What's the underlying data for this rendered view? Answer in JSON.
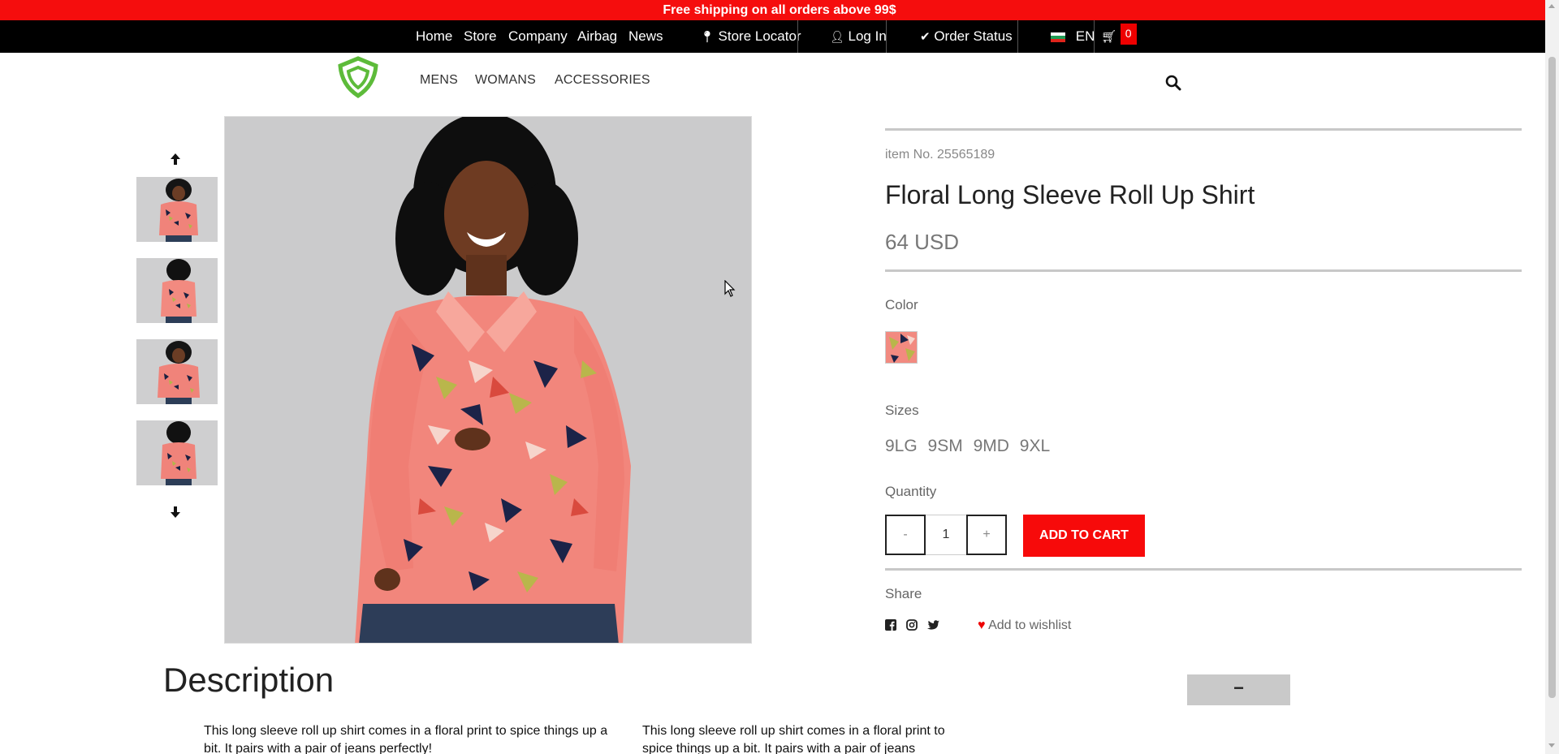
{
  "promo": {
    "text": "Free shipping on all orders above 99$"
  },
  "topnav": {
    "links": [
      "Home",
      "Store",
      "Company",
      "Airbag",
      "News"
    ],
    "store_locator": "Store Locator",
    "login": "Log In",
    "order_status": "Order Status",
    "language": "EN",
    "cart_count": "0"
  },
  "mainnav": {
    "items": [
      "MENS",
      "WOMANS",
      "ACCESSORIES"
    ]
  },
  "product": {
    "item_no": "item No. 25565189",
    "title": "Floral Long Sleeve Roll Up Shirt",
    "price": "64 USD",
    "color_label": "Color",
    "sizes_label": "Sizes",
    "sizes": [
      "9LG",
      "9SM",
      "9MD",
      "9XL"
    ],
    "quantity_label": "Quantity",
    "quantity": "1",
    "minus": "-",
    "plus": "+",
    "add_to_cart": "ADD TO CART",
    "share_label": "Share",
    "wishlist": "Add to wishlist"
  },
  "description": {
    "title": "Description",
    "collapse": "−",
    "text_left": "This long sleeve roll up shirt comes in a floral print to spice things up a bit. It pairs with a pair of jeans perfectly!",
    "text_right": "This long sleeve roll up shirt comes in a floral print to spice things up a bit. It pairs with a pair of jeans"
  },
  "colors": {
    "accent": "#f50d0d",
    "nav_bg": "#000000",
    "logo": "#5dbb3a"
  },
  "icons": [
    "map-marker-icon",
    "user-icon",
    "check-icon",
    "cart-icon",
    "search-icon",
    "arrow-up-icon",
    "arrow-down-icon",
    "facebook-icon",
    "instagram-icon",
    "twitter-icon",
    "heart-icon"
  ]
}
